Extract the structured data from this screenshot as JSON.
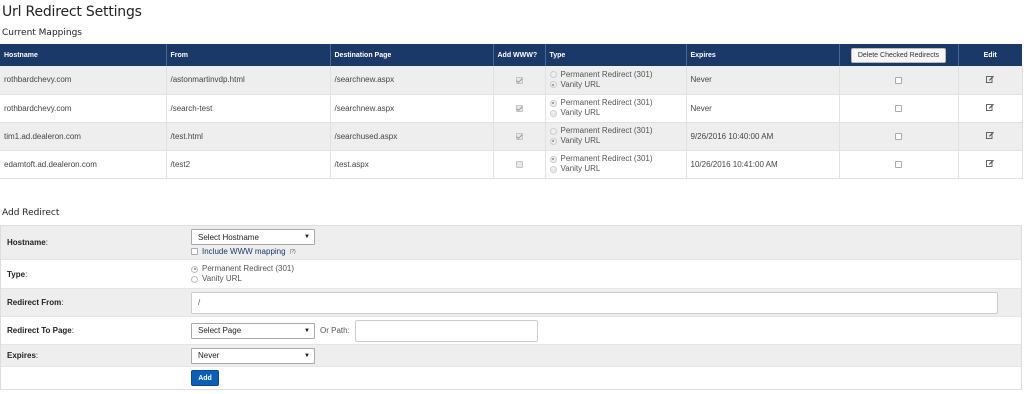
{
  "page_title": "Url Redirect Settings",
  "current_mappings_title": "Current Mappings",
  "table": {
    "headers": {
      "hostname": "Hostname",
      "from": "From",
      "destination": "Destination Page",
      "add_www": "Add WWW?",
      "type": "Type",
      "expires": "Expires",
      "delete_button": "Delete Checked Redirects",
      "edit": "Edit"
    },
    "type_options": [
      "Permanent Redirect (301)",
      "Vanity URL"
    ],
    "rows": [
      {
        "hostname": "rothbardchevy.com",
        "from": "/astonmartinvdp.html",
        "destination": "/searchnew.aspx",
        "add_www": true,
        "type": "vanity",
        "expires": "Never"
      },
      {
        "hostname": "rothbardchevy.com",
        "from": "/search-test",
        "destination": "/searchnew.aspx",
        "add_www": true,
        "type": "permanent",
        "expires": "Never"
      },
      {
        "hostname": "tim1.ad.dealeron.com",
        "from": "/test.html",
        "destination": "/searchused.aspx",
        "add_www": true,
        "type": "vanity",
        "expires": "9/26/2016 10:40:00 AM"
      },
      {
        "hostname": "edamtoft.ad.dealeron.com",
        "from": "/test2",
        "destination": "/test.aspx",
        "add_www": false,
        "type": "permanent",
        "expires": "10/26/2016 10:41:00 AM"
      }
    ]
  },
  "add_redirect": {
    "title": "Add Redirect",
    "hostname_label": "Hostname",
    "hostname_select": "Select Hostname",
    "include_www": "Include WWW mapping",
    "include_www_sup": "(?)",
    "type_label": "Type",
    "type_options": [
      "Permanent Redirect (301)",
      "Vanity URL"
    ],
    "type_selected": 0,
    "redirect_from_label": "Redirect From",
    "redirect_from_value": "/",
    "redirect_to_label": "Redirect To Page",
    "redirect_to_select": "Select Page",
    "or_path_label": "Or Path:",
    "or_path_value": "",
    "expires_label": "Expires",
    "expires_select": "Never",
    "add_button": "Add",
    "colon": ":"
  },
  "colors": {
    "header_bg": "#1a3868",
    "add_button": "#0b5fb8"
  }
}
